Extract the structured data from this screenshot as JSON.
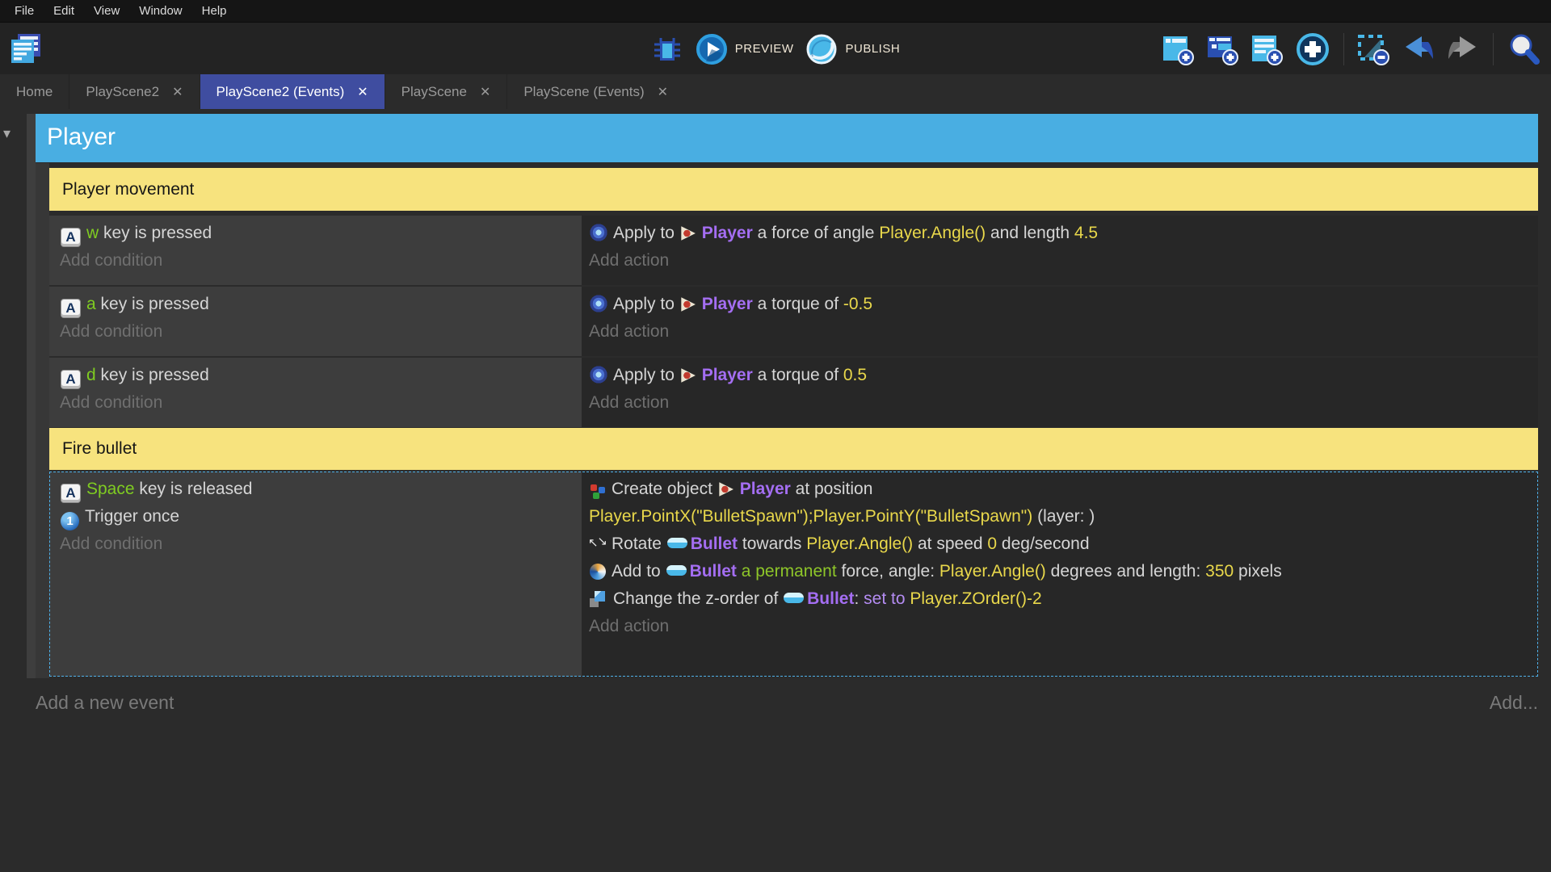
{
  "menu": {
    "items": [
      "File",
      "Edit",
      "View",
      "Window",
      "Help"
    ]
  },
  "toolbar": {
    "preview_label": "PREVIEW",
    "publish_label": "PUBLISH"
  },
  "tabs": {
    "items": [
      {
        "label": "Home",
        "closable": false,
        "active": false
      },
      {
        "label": "PlayScene2",
        "closable": true,
        "active": false
      },
      {
        "label": "PlayScene2 (Events)",
        "closable": true,
        "active": true
      },
      {
        "label": "PlayScene",
        "closable": true,
        "active": false
      },
      {
        "label": "PlayScene (Events)",
        "closable": true,
        "active": false
      }
    ]
  },
  "sheet": {
    "group": {
      "title": "Player"
    },
    "comments": {
      "movement": "Player movement",
      "fire": "Fire bullet"
    },
    "add_condition": "Add condition",
    "add_action": "Add action",
    "events": {
      "w_event": {
        "conditions": [
          [
            {
              "icon": "keyboard-icon"
            },
            {
              "t": "w",
              "s": "k"
            },
            {
              "t": " key is pressed"
            }
          ]
        ],
        "actions": [
          [
            {
              "icon": "force-icon"
            },
            {
              "t": "Apply to "
            },
            {
              "icon": "player-object-icon"
            },
            {
              "t": "Player",
              "s": "o"
            },
            {
              "t": " a force of angle "
            },
            {
              "t": "Player.Angle()",
              "s": "e"
            },
            {
              "t": " and length "
            },
            {
              "t": "4.5",
              "s": "e"
            }
          ]
        ]
      },
      "a_event": {
        "conditions": [
          [
            {
              "icon": "keyboard-icon"
            },
            {
              "t": "a",
              "s": "k"
            },
            {
              "t": " key is pressed"
            }
          ]
        ],
        "actions": [
          [
            {
              "icon": "force-icon"
            },
            {
              "t": "Apply to "
            },
            {
              "icon": "player-object-icon"
            },
            {
              "t": "Player",
              "s": "o"
            },
            {
              "t": " a torque of "
            },
            {
              "t": "-0.5",
              "s": "e"
            }
          ]
        ]
      },
      "d_event": {
        "conditions": [
          [
            {
              "icon": "keyboard-icon"
            },
            {
              "t": "d",
              "s": "k"
            },
            {
              "t": " key is pressed"
            }
          ]
        ],
        "actions": [
          [
            {
              "icon": "force-icon"
            },
            {
              "t": "Apply to "
            },
            {
              "icon": "player-object-icon"
            },
            {
              "t": "Player",
              "s": "o"
            },
            {
              "t": " a torque of "
            },
            {
              "t": "0.5",
              "s": "e"
            }
          ]
        ]
      },
      "fire_event": {
        "conditions": [
          [
            {
              "icon": "keyboard-icon"
            },
            {
              "t": "Space",
              "s": "k"
            },
            {
              "t": " key is released"
            }
          ],
          [
            {
              "icon": "trigger-once-icon"
            },
            {
              "t": "Trigger once"
            }
          ]
        ],
        "actions": [
          [
            {
              "icon": "create-object-icon"
            },
            {
              "t": "Create object "
            },
            {
              "icon": "player-object-icon"
            },
            {
              "t": "Player",
              "s": "o"
            },
            {
              "t": " at position"
            }
          ],
          [
            {
              "t": "Player.PointX(\"BulletSpawn\");Player.PointY(\"BulletSpawn\")",
              "s": "e"
            },
            {
              "t": " (layer: )"
            }
          ],
          [
            {
              "icon": "rotate-icon"
            },
            {
              "t": "Rotate "
            },
            {
              "icon": "bullet-object-icon"
            },
            {
              "t": "Bullet",
              "s": "o"
            },
            {
              "t": " towards "
            },
            {
              "t": "Player.Angle()",
              "s": "e"
            },
            {
              "t": " at speed "
            },
            {
              "t": "0",
              "s": "e"
            },
            {
              "t": " deg/second"
            }
          ],
          [
            {
              "icon": "add-force-icon"
            },
            {
              "t": "Add to "
            },
            {
              "icon": "bullet-object-icon"
            },
            {
              "t": "Bullet",
              "s": "o"
            },
            {
              "t": " a permanent",
              "s": "g"
            },
            {
              "t": " force, angle: "
            },
            {
              "t": "Player.Angle()",
              "s": "e"
            },
            {
              "t": " degrees and length: "
            },
            {
              "t": "350",
              "s": "e"
            },
            {
              "t": " pixels"
            }
          ],
          [
            {
              "icon": "zorder-icon"
            },
            {
              "t": "Change the z-order of "
            },
            {
              "icon": "bullet-object-icon"
            },
            {
              "t": "Bullet",
              "s": "o"
            },
            {
              "t": ": "
            },
            {
              "t": "set to ",
              "s": "v"
            },
            {
              "t": "Player.ZOrder()-2",
              "s": "e"
            }
          ]
        ]
      }
    }
  },
  "footer": {
    "add_new_event": "Add a new event",
    "add_more": "Add..."
  },
  "colors": {
    "group_header": "#49aee2",
    "comment_bg": "#f7e37e",
    "active_tab": "#3f4da0",
    "object_name": "#a46ef2",
    "expression": "#e9d84b",
    "key_highlight": "#7fcc21",
    "permanent_force": "#8ec629",
    "set_to": "#b48cf2",
    "selection_border": "#4fb0e8",
    "condition_column_bg": "#3d3d3d",
    "action_column_bg": "#272727"
  }
}
